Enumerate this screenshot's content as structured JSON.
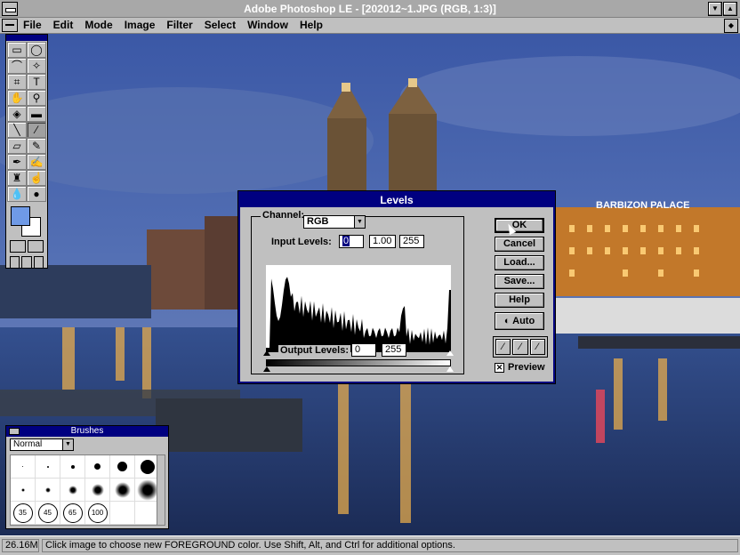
{
  "window": {
    "title": "Adobe Photoshop LE - [202012~1.JPG  (RGB, 1:3)]"
  },
  "menu": [
    "File",
    "Edit",
    "Mode",
    "Image",
    "Filter",
    "Select",
    "Window",
    "Help"
  ],
  "status": {
    "size": "26.16M",
    "message": "Click image to choose new FOREGROUND color.  Use Shift, Alt, and Ctrl for additional options."
  },
  "scene": {
    "sign_text": "BARBIZON PALACE"
  },
  "brushes": {
    "title": "Brushes",
    "mode": "Normal",
    "sizes": [
      "35",
      "45",
      "65",
      "100"
    ]
  },
  "levels": {
    "title": "Levels",
    "channel_label": "Channel:",
    "channel": "RGB",
    "input_label": "Input Levels:",
    "input_black": "0",
    "input_gamma": "1.00",
    "input_white": "255",
    "output_label": "Output Levels:",
    "output_black": "0",
    "output_white": "255",
    "buttons": {
      "ok": "OK",
      "cancel": "Cancel",
      "load": "Load...",
      "save": "Save...",
      "help": "Help",
      "auto": "Auto"
    },
    "preview_label": "Preview",
    "preview_checked": true
  },
  "colors": {
    "foreground": "#6f9ae6",
    "background": "#ffffff",
    "titlebar": "#000080"
  }
}
